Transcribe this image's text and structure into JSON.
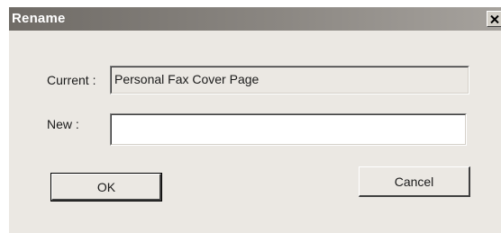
{
  "window": {
    "title": "Rename",
    "close_icon": "close-icon"
  },
  "fields": {
    "current_label": "Current :",
    "current_value": "Personal Fax Cover Page",
    "new_label": "New :",
    "new_value": ""
  },
  "buttons": {
    "ok_label": "OK",
    "cancel_label": "Cancel"
  }
}
